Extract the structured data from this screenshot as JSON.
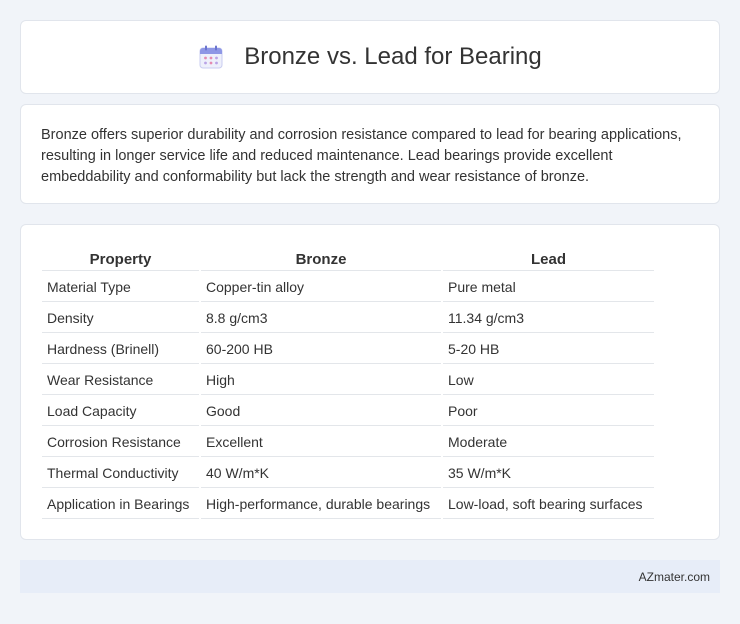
{
  "header": {
    "title": "Bronze vs. Lead for Bearing",
    "icon": "calendar-icon"
  },
  "summary": {
    "text": "Bronze offers superior durability and corrosion resistance compared to lead for bearing applications, resulting in longer service life and reduced maintenance. Lead bearings provide excellent embeddability and conformability but lack the strength and wear resistance of bronze."
  },
  "table": {
    "headers": [
      "Property",
      "Bronze",
      "Lead"
    ],
    "rows": [
      [
        "Material Type",
        "Copper-tin alloy",
        "Pure metal"
      ],
      [
        "Density",
        "8.8 g/cm3",
        "11.34 g/cm3"
      ],
      [
        "Hardness (Brinell)",
        "60-200 HB",
        "5-20 HB"
      ],
      [
        "Wear Resistance",
        "High",
        "Low"
      ],
      [
        "Load Capacity",
        "Good",
        "Poor"
      ],
      [
        "Corrosion Resistance",
        "Excellent",
        "Moderate"
      ],
      [
        "Thermal Conductivity",
        "40 W/m*K",
        "35 W/m*K"
      ],
      [
        "Application in Bearings",
        "High-performance, durable bearings",
        "Low-load, soft bearing surfaces"
      ]
    ]
  },
  "footer": {
    "site": "AZmater.com"
  },
  "colors": {
    "background": "#f1f4f9",
    "card": "#ffffff",
    "footer_bg": "#e7edf8"
  }
}
